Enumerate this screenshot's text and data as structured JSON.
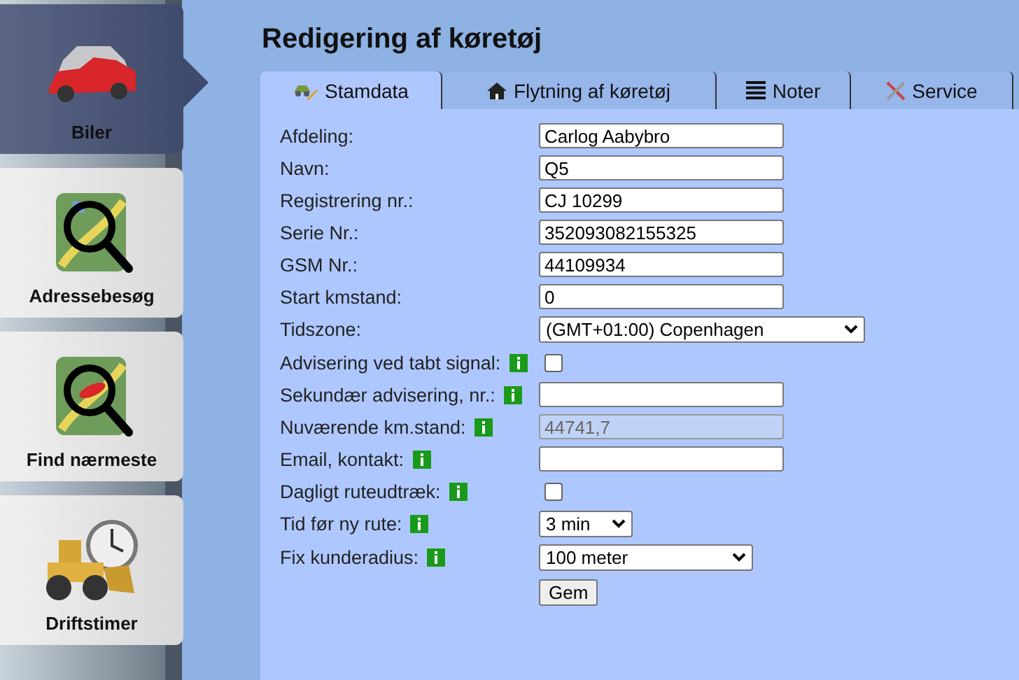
{
  "sidebar": {
    "items": [
      {
        "label": "Biler",
        "selected": true
      },
      {
        "label": "Adressebesøg",
        "selected": false
      },
      {
        "label": "Find nærmeste",
        "selected": false
      },
      {
        "label": "Driftstimer",
        "selected": false
      }
    ]
  },
  "title": "Redigering af køretøj",
  "tabs": [
    {
      "label": "Stamdata",
      "selected": true
    },
    {
      "label": "Flytning af køretøj",
      "selected": false
    },
    {
      "label": "Noter",
      "selected": false
    },
    {
      "label": "Service",
      "selected": false
    }
  ],
  "form": {
    "rows": [
      {
        "label": "Afdeling:",
        "kind": "text",
        "value": "Carlog Aabybro",
        "info": false,
        "disabled": false
      },
      {
        "label": "Navn:",
        "kind": "text",
        "value": "Q5",
        "info": false,
        "disabled": false
      },
      {
        "label": "Registrering nr.:",
        "kind": "text",
        "value": "CJ 10299",
        "info": false,
        "disabled": false
      },
      {
        "label": "Serie Nr.:",
        "kind": "text",
        "value": "352093082155325",
        "info": false,
        "disabled": false
      },
      {
        "label": "GSM Nr.:",
        "kind": "text",
        "value": "44109934",
        "info": false,
        "disabled": false
      },
      {
        "label": "Start kmstand:",
        "kind": "text",
        "value": "0",
        "info": false,
        "disabled": false
      },
      {
        "label": "Tidszone:",
        "kind": "select",
        "value": "(GMT+01:00) Copenhagen",
        "info": false
      },
      {
        "label": "Advisering ved tabt signal:",
        "kind": "checkbox",
        "checked": false,
        "info": true
      },
      {
        "label": "Sekundær advisering, nr.:",
        "kind": "text",
        "info": true,
        "disabled": false
      },
      {
        "label": "Nuværende km.stand:",
        "kind": "text",
        "value": "44741,7",
        "info": true,
        "disabled": true
      },
      {
        "label": "Email, kontakt:",
        "kind": "text",
        "info": true,
        "disabled": false
      },
      {
        "label": "Dagligt ruteudtræk:",
        "kind": "checkbox",
        "checked": false,
        "info": true
      },
      {
        "label": "Tid før ny rute:",
        "kind": "select",
        "value": "3 min",
        "info": true
      },
      {
        "label": "Fix kunderadius:",
        "kind": "select",
        "value": "100 meter",
        "info": true
      }
    ],
    "submit": "Gem"
  }
}
